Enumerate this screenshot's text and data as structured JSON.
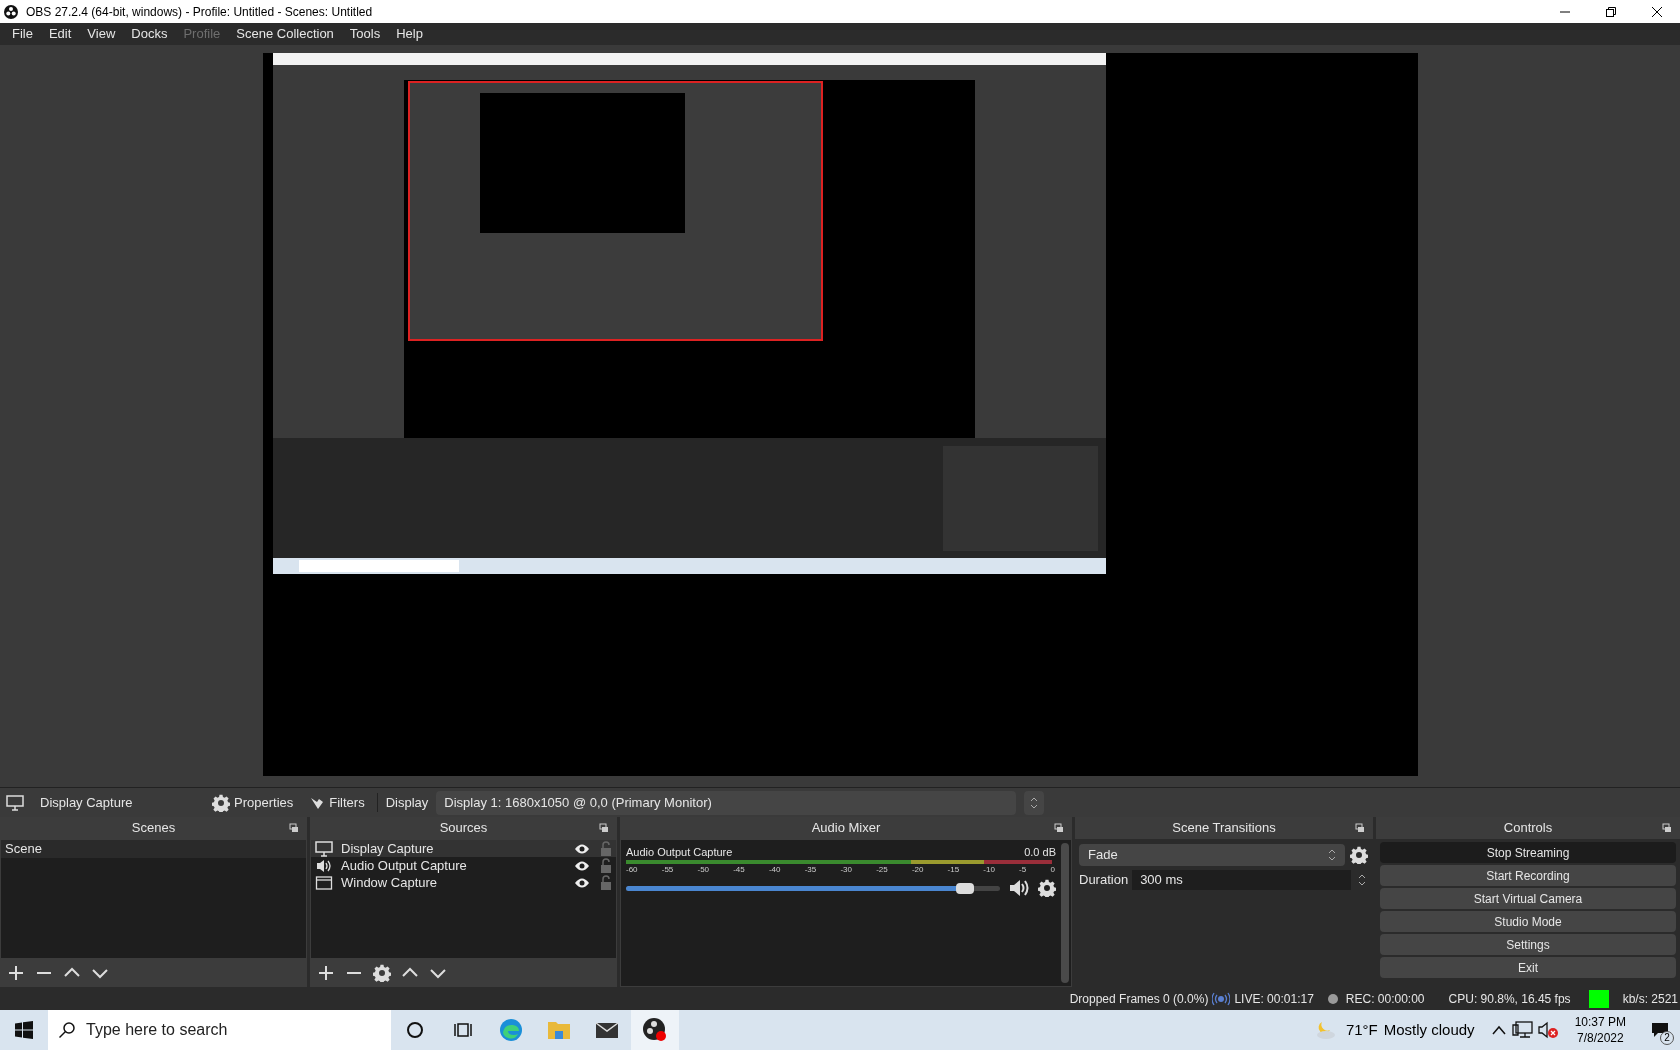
{
  "window": {
    "title": "OBS 27.2.4 (64-bit, windows) - Profile: Untitled - Scenes: Untitled"
  },
  "menu": [
    {
      "label": "File",
      "disabled": false
    },
    {
      "label": "Edit",
      "disabled": false
    },
    {
      "label": "View",
      "disabled": false
    },
    {
      "label": "Docks",
      "disabled": false
    },
    {
      "label": "Profile",
      "disabled": true
    },
    {
      "label": "Scene Collection",
      "disabled": false
    },
    {
      "label": "Tools",
      "disabled": false
    },
    {
      "label": "Help",
      "disabled": false
    }
  ],
  "source_toolbar": {
    "source": "Display Capture",
    "properties": "Properties",
    "filters": "Filters",
    "property_label": "Display",
    "display_value": "Display 1: 1680x1050 @ 0,0 (Primary Monitor)"
  },
  "scenes": {
    "title": "Scenes",
    "items": [
      {
        "label": "Scene",
        "selected": true
      }
    ]
  },
  "sources": {
    "title": "Sources",
    "items": [
      {
        "kind": "display",
        "label": "Display Capture",
        "selected": true,
        "visible": true,
        "locked": false
      },
      {
        "kind": "audio",
        "label": "Audio Output Capture",
        "selected": false,
        "visible": true,
        "locked": false
      },
      {
        "kind": "window",
        "label": "Window Capture",
        "selected": false,
        "visible": true,
        "locked": false
      }
    ]
  },
  "audio_mixer": {
    "title": "Audio Mixer",
    "scale": [
      "-60",
      "-55",
      "-50",
      "-45",
      "-40",
      "-35",
      "-30",
      "-25",
      "-20",
      "-15",
      "-10",
      "-5",
      "0"
    ],
    "channels": [
      {
        "name": "Audio Output Capture",
        "reading": "0.0 dB",
        "level": 0.93,
        "muted": false
      }
    ]
  },
  "scene_transitions": {
    "title": "Scene Transitions",
    "transition": "Fade",
    "duration_label": "Duration",
    "duration": "300 ms"
  },
  "controls": {
    "title": "Controls",
    "buttons": [
      {
        "label": "Stop Streaming",
        "active": true
      },
      {
        "label": "Start Recording",
        "active": false
      },
      {
        "label": "Start Virtual Camera",
        "active": false
      },
      {
        "label": "Studio Mode",
        "active": false
      },
      {
        "label": "Settings",
        "active": false
      },
      {
        "label": "Exit",
        "active": false
      }
    ]
  },
  "status_bar": {
    "dropped_frames": "Dropped Frames 0 (0.0%)",
    "live": "LIVE: 00:01:17",
    "rec": "REC: 00:00:00",
    "cpu": "CPU: 90.8%, 16.45 fps",
    "bitrate": "kb/s: 2521"
  },
  "taskbar": {
    "search_placeholder": "Type here to search",
    "temperature": "71°F",
    "weather": "Mostly cloudy",
    "time": "10:37 PM",
    "date": "7/8/2022",
    "notifications": "2"
  }
}
